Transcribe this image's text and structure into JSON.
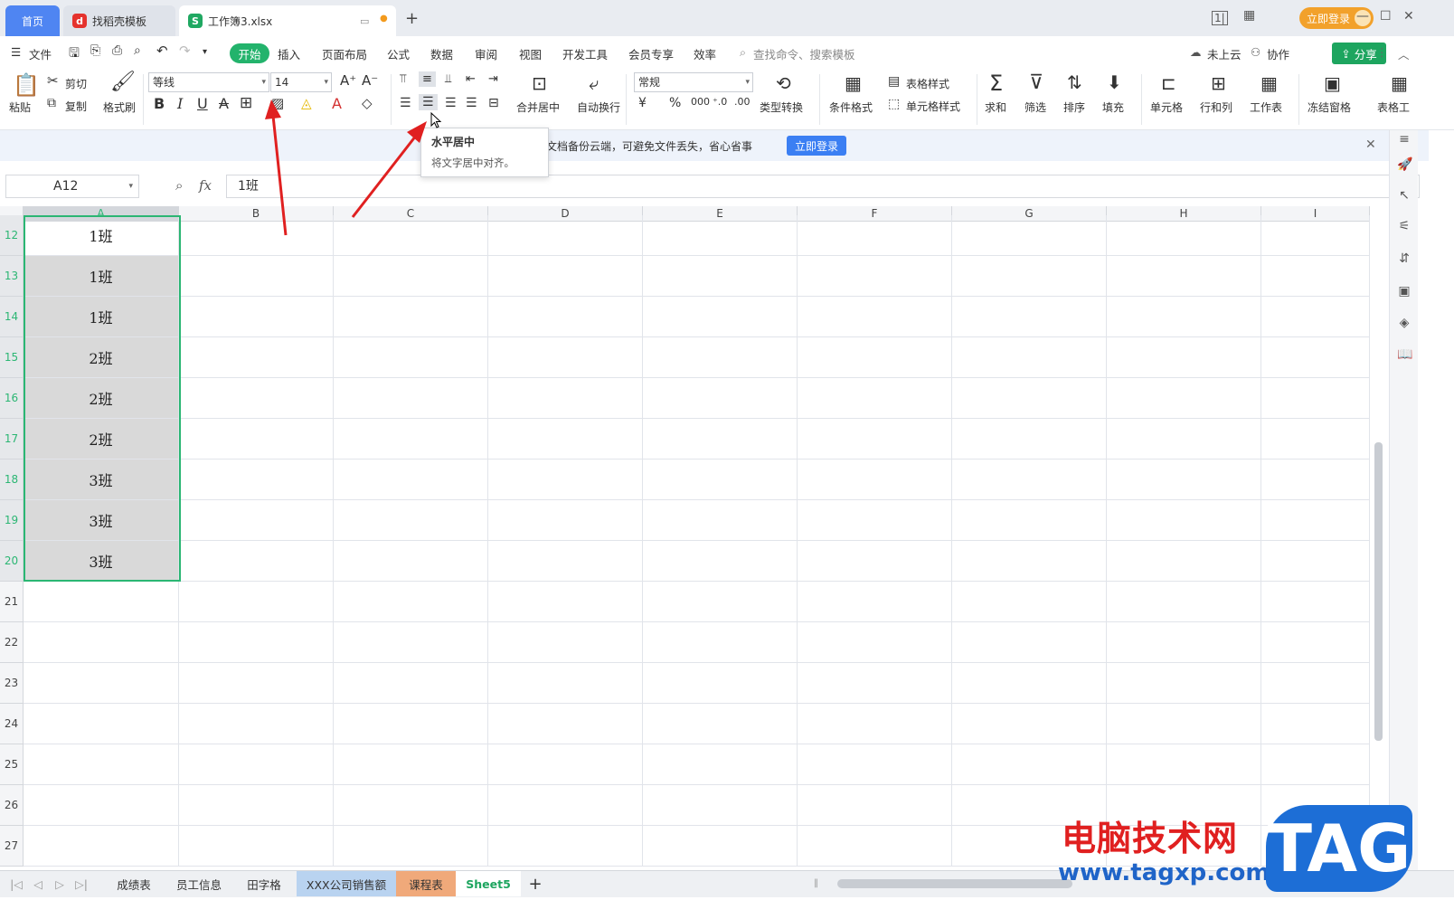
{
  "titlebar": {
    "tab_home": "首页",
    "tab_template": "找稻壳模板",
    "tab_workbook": "工作簿3.xlsx",
    "new_tab": "+",
    "login": "立即登录",
    "minimize": "—",
    "maximize": "☐",
    "close": "✕"
  },
  "menubar": {
    "file": "文件",
    "items": [
      "开始",
      "插入",
      "页面布局",
      "公式",
      "数据",
      "审阅",
      "视图",
      "开发工具",
      "会员专享",
      "效率"
    ],
    "search_placeholder": "查找命令、搜索模板",
    "cloud": "未上云",
    "collab": "协作",
    "share": "分享"
  },
  "ribbon": {
    "paste": "粘贴",
    "cut": "剪切",
    "copy": "复制",
    "format_painter": "格式刷",
    "font_name": "等线",
    "font_size": "14",
    "merge_center": "合并居中",
    "auto_wrap": "自动换行",
    "number_format": "常规",
    "type_convert": "类型转换",
    "cond_format": "条件格式",
    "table_style": "表格样式",
    "cell_style": "单元格样式",
    "sum": "求和",
    "filter": "筛选",
    "sort": "排序",
    "fill": "填充",
    "cell": "单元格",
    "row_col": "行和列",
    "worksheet": "工作表",
    "freeze": "冻结窗格",
    "table_tools": "表格工"
  },
  "notice": {
    "text": "将文档备份云端，可避免文件丢失，省心省事",
    "button": "立即登录"
  },
  "formula": {
    "cell_ref": "A12",
    "fx": "fx",
    "value": "1班"
  },
  "tooltip": {
    "title": "水平居中",
    "desc": "将文字居中对齐。"
  },
  "grid": {
    "columns": [
      "A",
      "B",
      "C",
      "D",
      "E",
      "F",
      "G",
      "H",
      "I"
    ],
    "rows": [
      "12",
      "13",
      "14",
      "15",
      "16",
      "17",
      "18",
      "19",
      "20",
      "21",
      "22",
      "23",
      "24",
      "25",
      "26",
      "27"
    ],
    "column_a_values": [
      "1班",
      "1班",
      "1班",
      "2班",
      "2班",
      "2班",
      "3班",
      "3班",
      "3班"
    ]
  },
  "sheets": {
    "tabs": [
      "成绩表",
      "员工信息",
      "田字格",
      "XXX公司销售额",
      "课程表",
      "Sheet5"
    ],
    "active": "Sheet5",
    "add": "+"
  },
  "watermark": {
    "site_cn": "电脑技术网",
    "site_url": "www.tagxp.com",
    "logo": "TAG"
  },
  "colors": {
    "accent_green": "#23b36c",
    "selection_border": "#2bb673",
    "home_tab": "#4f85f2",
    "login_orange": "#f2a12b",
    "annotation_arrow": "#e02020"
  }
}
